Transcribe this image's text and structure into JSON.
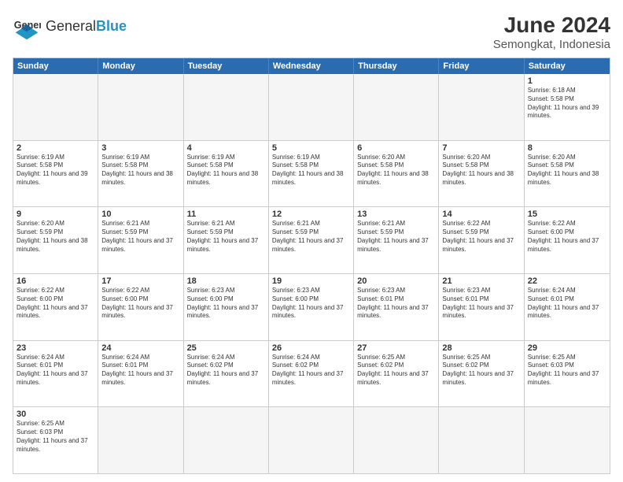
{
  "logo": {
    "text_general": "General",
    "text_blue": "Blue"
  },
  "title": "June 2024",
  "subtitle": "Semongkat, Indonesia",
  "days": [
    "Sunday",
    "Monday",
    "Tuesday",
    "Wednesday",
    "Thursday",
    "Friday",
    "Saturday"
  ],
  "weeks": [
    [
      {
        "day": "",
        "empty": true
      },
      {
        "day": "",
        "empty": true
      },
      {
        "day": "",
        "empty": true
      },
      {
        "day": "",
        "empty": true
      },
      {
        "day": "",
        "empty": true
      },
      {
        "day": "",
        "empty": true
      },
      {
        "day": "1",
        "sunrise": "6:18 AM",
        "sunset": "5:58 PM",
        "daylight": "11 hours and 39 minutes."
      }
    ],
    [
      {
        "day": "2",
        "sunrise": "6:19 AM",
        "sunset": "5:58 PM",
        "daylight": "11 hours and 39 minutes."
      },
      {
        "day": "3",
        "sunrise": "6:19 AM",
        "sunset": "5:58 PM",
        "daylight": "11 hours and 38 minutes."
      },
      {
        "day": "4",
        "sunrise": "6:19 AM",
        "sunset": "5:58 PM",
        "daylight": "11 hours and 38 minutes."
      },
      {
        "day": "5",
        "sunrise": "6:19 AM",
        "sunset": "5:58 PM",
        "daylight": "11 hours and 38 minutes."
      },
      {
        "day": "6",
        "sunrise": "6:20 AM",
        "sunset": "5:58 PM",
        "daylight": "11 hours and 38 minutes."
      },
      {
        "day": "7",
        "sunrise": "6:20 AM",
        "sunset": "5:58 PM",
        "daylight": "11 hours and 38 minutes."
      },
      {
        "day": "8",
        "sunrise": "6:20 AM",
        "sunset": "5:58 PM",
        "daylight": "11 hours and 38 minutes."
      }
    ],
    [
      {
        "day": "9",
        "sunrise": "6:20 AM",
        "sunset": "5:59 PM",
        "daylight": "11 hours and 38 minutes."
      },
      {
        "day": "10",
        "sunrise": "6:21 AM",
        "sunset": "5:59 PM",
        "daylight": "11 hours and 37 minutes."
      },
      {
        "day": "11",
        "sunrise": "6:21 AM",
        "sunset": "5:59 PM",
        "daylight": "11 hours and 37 minutes."
      },
      {
        "day": "12",
        "sunrise": "6:21 AM",
        "sunset": "5:59 PM",
        "daylight": "11 hours and 37 minutes."
      },
      {
        "day": "13",
        "sunrise": "6:21 AM",
        "sunset": "5:59 PM",
        "daylight": "11 hours and 37 minutes."
      },
      {
        "day": "14",
        "sunrise": "6:22 AM",
        "sunset": "5:59 PM",
        "daylight": "11 hours and 37 minutes."
      },
      {
        "day": "15",
        "sunrise": "6:22 AM",
        "sunset": "6:00 PM",
        "daylight": "11 hours and 37 minutes."
      }
    ],
    [
      {
        "day": "16",
        "sunrise": "6:22 AM",
        "sunset": "6:00 PM",
        "daylight": "11 hours and 37 minutes."
      },
      {
        "day": "17",
        "sunrise": "6:22 AM",
        "sunset": "6:00 PM",
        "daylight": "11 hours and 37 minutes."
      },
      {
        "day": "18",
        "sunrise": "6:23 AM",
        "sunset": "6:00 PM",
        "daylight": "11 hours and 37 minutes."
      },
      {
        "day": "19",
        "sunrise": "6:23 AM",
        "sunset": "6:00 PM",
        "daylight": "11 hours and 37 minutes."
      },
      {
        "day": "20",
        "sunrise": "6:23 AM",
        "sunset": "6:01 PM",
        "daylight": "11 hours and 37 minutes."
      },
      {
        "day": "21",
        "sunrise": "6:23 AM",
        "sunset": "6:01 PM",
        "daylight": "11 hours and 37 minutes."
      },
      {
        "day": "22",
        "sunrise": "6:24 AM",
        "sunset": "6:01 PM",
        "daylight": "11 hours and 37 minutes."
      }
    ],
    [
      {
        "day": "23",
        "sunrise": "6:24 AM",
        "sunset": "6:01 PM",
        "daylight": "11 hours and 37 minutes."
      },
      {
        "day": "24",
        "sunrise": "6:24 AM",
        "sunset": "6:01 PM",
        "daylight": "11 hours and 37 minutes."
      },
      {
        "day": "25",
        "sunrise": "6:24 AM",
        "sunset": "6:02 PM",
        "daylight": "11 hours and 37 minutes."
      },
      {
        "day": "26",
        "sunrise": "6:24 AM",
        "sunset": "6:02 PM",
        "daylight": "11 hours and 37 minutes."
      },
      {
        "day": "27",
        "sunrise": "6:25 AM",
        "sunset": "6:02 PM",
        "daylight": "11 hours and 37 minutes."
      },
      {
        "day": "28",
        "sunrise": "6:25 AM",
        "sunset": "6:02 PM",
        "daylight": "11 hours and 37 minutes."
      },
      {
        "day": "29",
        "sunrise": "6:25 AM",
        "sunset": "6:03 PM",
        "daylight": "11 hours and 37 minutes."
      }
    ],
    [
      {
        "day": "30",
        "sunrise": "6:25 AM",
        "sunset": "6:03 PM",
        "daylight": "11 hours and 37 minutes."
      },
      {
        "day": "",
        "empty": true
      },
      {
        "day": "",
        "empty": true
      },
      {
        "day": "",
        "empty": true
      },
      {
        "day": "",
        "empty": true
      },
      {
        "day": "",
        "empty": true
      },
      {
        "day": "",
        "empty": true
      }
    ]
  ]
}
